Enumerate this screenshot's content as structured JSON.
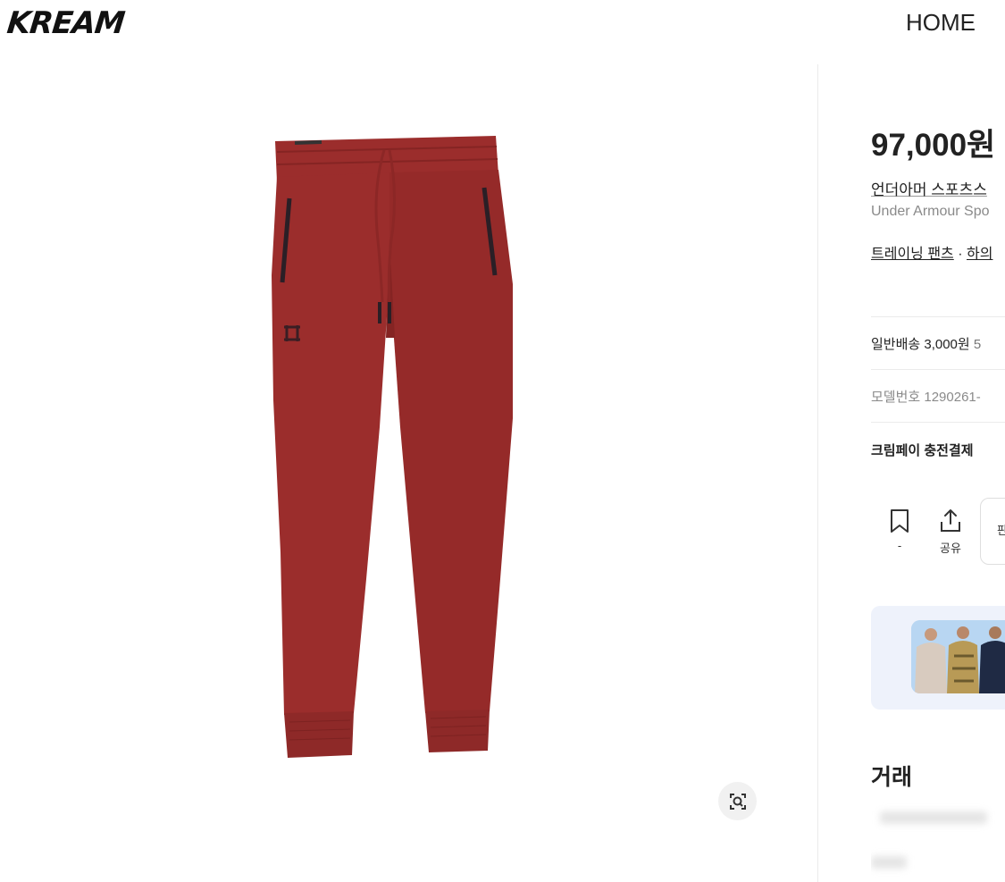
{
  "header": {
    "logo": "KREAM",
    "nav": {
      "home": "HOME"
    }
  },
  "gallery": {
    "image_icon": "pants-image",
    "lens_icon": "lens-search-icon"
  },
  "product": {
    "price": "97,000원",
    "name_ko": "언더아머 스포츠스",
    "name_en": "Under Armour Spo",
    "categories": [
      {
        "label": "트레이닝 팬츠"
      },
      {
        "label": "하의"
      }
    ],
    "category_separator": "·"
  },
  "info": {
    "shipping_label": "일반배송 3,000원",
    "shipping_rest": "5",
    "model_label": "모델번호 1290261-",
    "krimpay": "크림페이 충전결제"
  },
  "actions": {
    "bookmark_count": "-",
    "share_label": "공유",
    "third_label": "판"
  },
  "trade": {
    "title": "거래"
  },
  "colors": {
    "pants": "#9b2d2c",
    "pants_shadow": "#852423",
    "zipper": "#2a1f26",
    "banner_bg": "#eef2fb"
  }
}
